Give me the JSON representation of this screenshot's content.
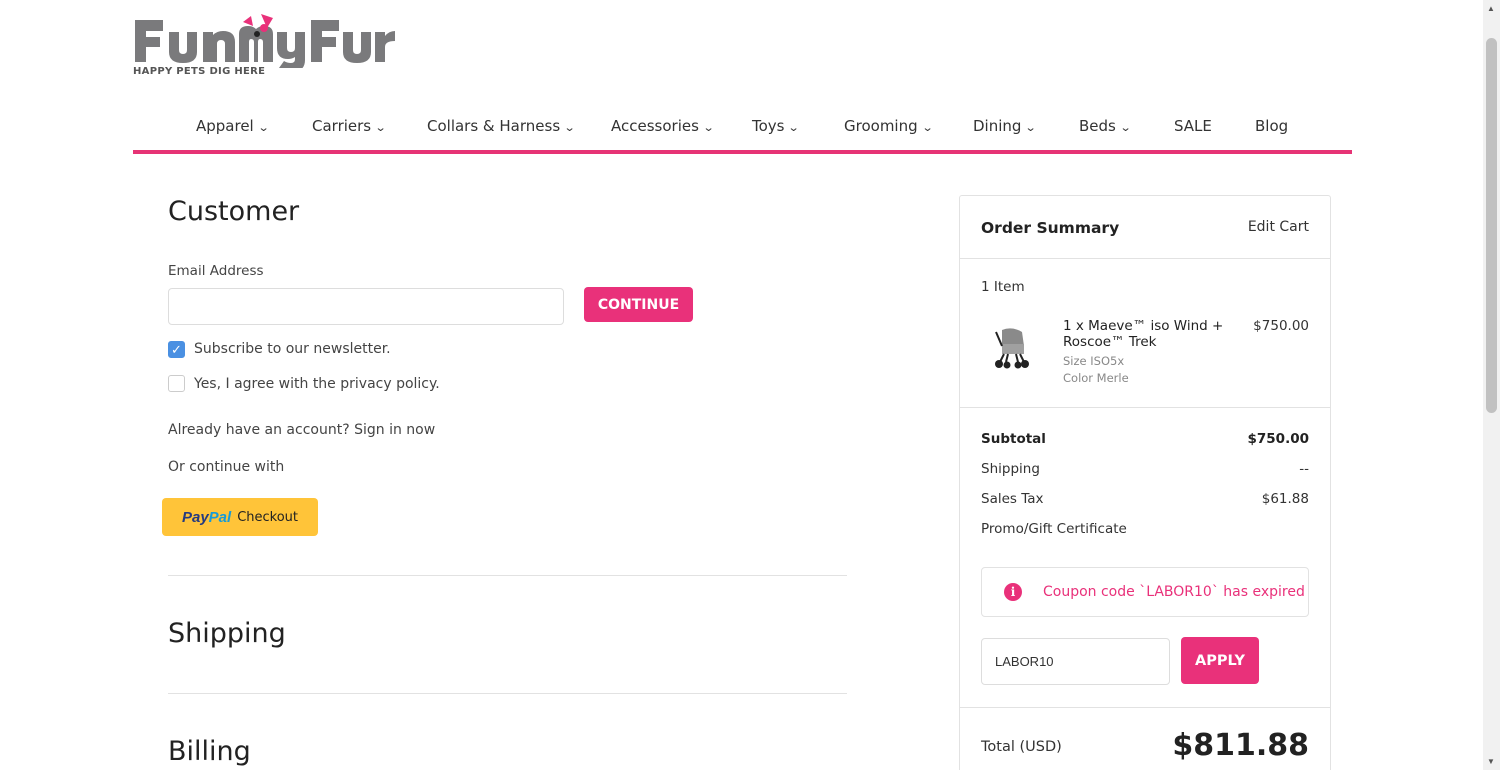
{
  "brand": {
    "name": "FunnyFur",
    "tagline": "HAPPY PETS DIG HERE",
    "accent": "#e9317a"
  },
  "nav": {
    "items": [
      {
        "label": "Apparel",
        "dropdown": true
      },
      {
        "label": "Carriers",
        "dropdown": true
      },
      {
        "label": "Collars & Harness",
        "dropdown": true
      },
      {
        "label": "Accessories",
        "dropdown": true
      },
      {
        "label": "Toys",
        "dropdown": true
      },
      {
        "label": "Grooming",
        "dropdown": true
      },
      {
        "label": "Dining",
        "dropdown": true
      },
      {
        "label": "Beds",
        "dropdown": true
      },
      {
        "label": "SALE",
        "dropdown": false
      },
      {
        "label": "Blog",
        "dropdown": false
      }
    ]
  },
  "customer": {
    "title": "Customer",
    "email_label": "Email Address",
    "email_value": "",
    "continue_label": "CONTINUE",
    "newsletter_label": "Subscribe to our newsletter.",
    "newsletter_checked": true,
    "privacy_label": "Yes, I agree with the privacy policy.",
    "privacy_checked": false,
    "signin_text": "Already have an account? Sign in now",
    "or_continue": "Or continue with",
    "paypal": {
      "pay": "Pay",
      "pal": "Pal",
      "checkout": "Checkout"
    }
  },
  "shipping": {
    "title": "Shipping"
  },
  "billing": {
    "title": "Billing"
  },
  "summary": {
    "title": "Order Summary",
    "edit_cart": "Edit Cart",
    "item_count": "1 Item",
    "item": {
      "name": "1 x Maeve™ iso Wind + Roscoe™ Trek",
      "price": "$750.00",
      "size": "Size ISO5x",
      "color": "Color Merle"
    },
    "subtotal_label": "Subtotal",
    "subtotal_value": "$750.00",
    "shipping_label": "Shipping",
    "shipping_value": "--",
    "tax_label": "Sales Tax",
    "tax_value": "$61.88",
    "promo_label": "Promo/Gift Certificate",
    "alert_text": "Coupon code `LABOR10` has expired",
    "coupon_value": "LABOR10",
    "apply_label": "APPLY",
    "total_label": "Total (USD)",
    "total_value": "$811.88"
  }
}
